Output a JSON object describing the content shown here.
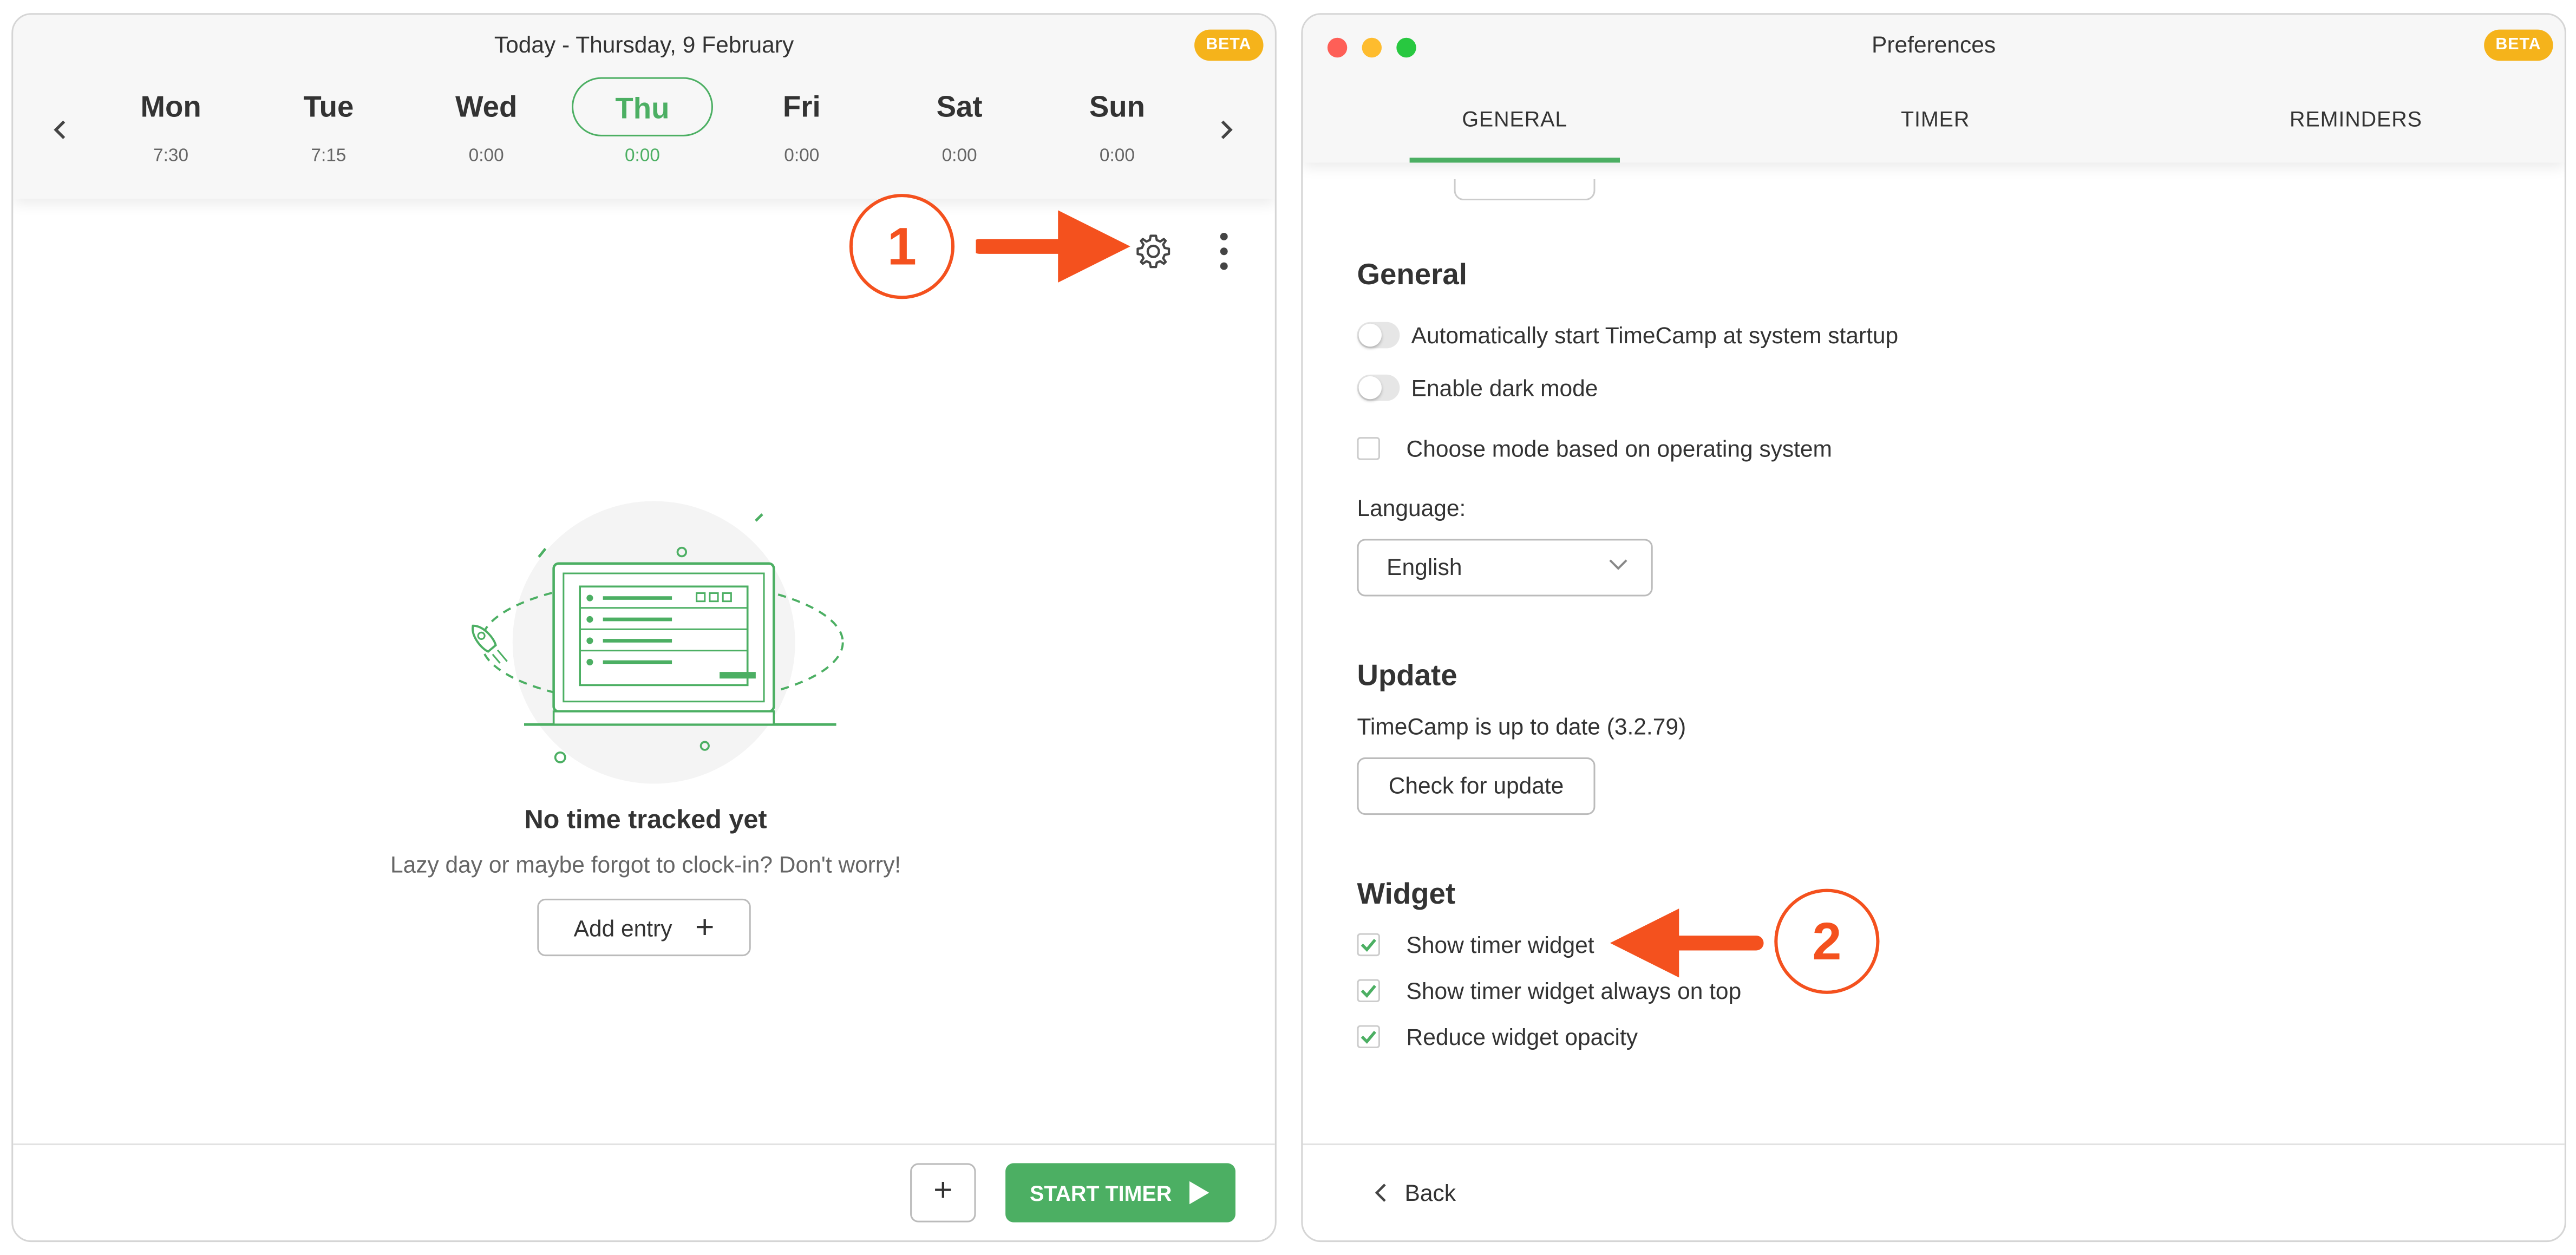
{
  "left_window": {
    "title": "Today - Thursday, 9 February",
    "beta": "BETA",
    "days": [
      {
        "name": "Mon",
        "time": "7:30"
      },
      {
        "name": "Tue",
        "time": "7:15"
      },
      {
        "name": "Wed",
        "time": "0:00"
      },
      {
        "name": "Thu",
        "time": "0:00",
        "active": true
      },
      {
        "name": "Fri",
        "time": "0:00"
      },
      {
        "name": "Sat",
        "time": "0:00"
      },
      {
        "name": "Sun",
        "time": "0:00"
      }
    ],
    "empty_title": "No time tracked yet",
    "empty_subtitle": "Lazy day or maybe forgot to clock-in? Don't worry!",
    "add_entry": "Add entry",
    "start_timer": "START TIMER"
  },
  "right_window": {
    "title": "Preferences",
    "beta": "BETA",
    "tabs": [
      "GENERAL",
      "TIMER",
      "REMINDERS"
    ],
    "active_tab": "GENERAL",
    "general": {
      "heading": "General",
      "auto_start": "Automatically start TimeCamp at system startup",
      "dark_mode": "Enable dark mode",
      "os_mode": "Choose mode based on operating system",
      "language_label": "Language:",
      "language_value": "English"
    },
    "update": {
      "heading": "Update",
      "status": "TimeCamp is up to date (3.2.79)",
      "check_button": "Check for update"
    },
    "widget": {
      "heading": "Widget",
      "show_widget": "Show timer widget",
      "always_on_top": "Show timer widget always on top",
      "reduce_opacity": "Reduce widget opacity"
    },
    "back": "Back"
  },
  "annotations": {
    "step1": "1",
    "step2": "2"
  },
  "colors": {
    "accent_green": "#4caf63",
    "annotation_orange": "#f4511e",
    "beta_yellow": "#f5b31b"
  }
}
